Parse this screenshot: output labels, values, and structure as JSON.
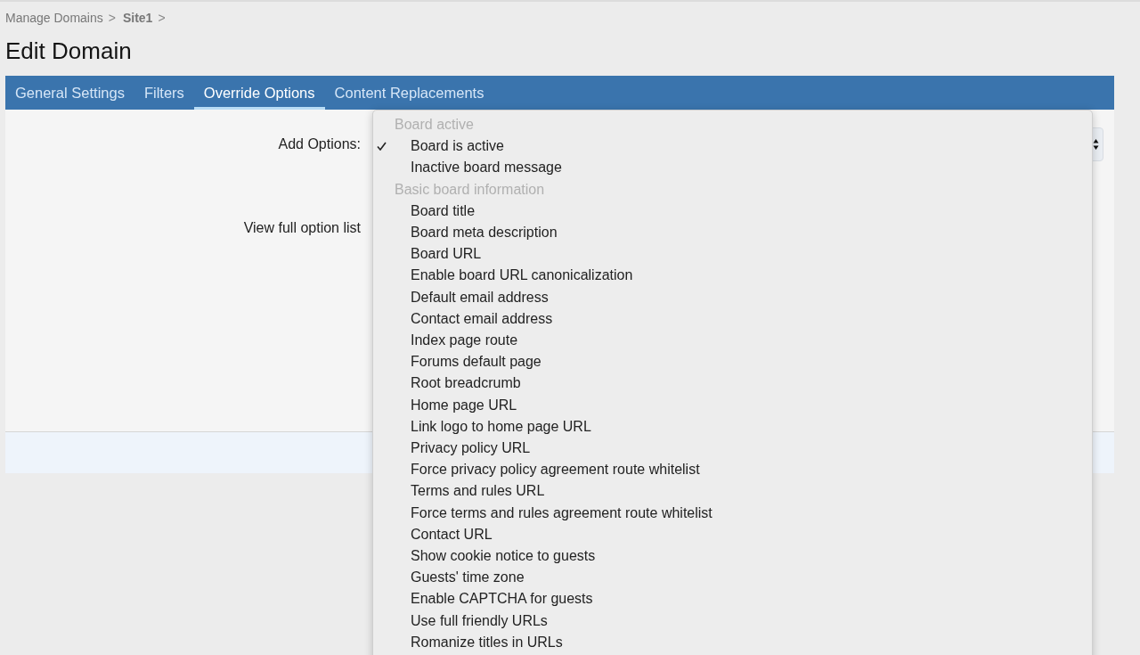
{
  "breadcrumb": [
    {
      "label": "Manage Domains",
      "bold": false
    },
    {
      "label": "Site1",
      "bold": true
    }
  ],
  "breadcrumb_separator": ">",
  "title": "Edit Domain",
  "tabs": [
    {
      "label": "General Settings",
      "selected": false
    },
    {
      "label": "Filters",
      "selected": false
    },
    {
      "label": "Override Options",
      "selected": true
    },
    {
      "label": "Content Replacements",
      "selected": false
    }
  ],
  "form": {
    "add_options_label": "Add Options:",
    "view_full_link": "View full option list"
  },
  "dropdown": [
    {
      "kind": "group",
      "label": "Board active"
    },
    {
      "kind": "option",
      "label": "Board is active",
      "checked": true
    },
    {
      "kind": "option",
      "label": "Inactive board message",
      "checked": false
    },
    {
      "kind": "group",
      "label": "Basic board information"
    },
    {
      "kind": "option",
      "label": "Board title",
      "checked": false
    },
    {
      "kind": "option",
      "label": "Board meta description",
      "checked": false
    },
    {
      "kind": "option",
      "label": "Board URL",
      "checked": false
    },
    {
      "kind": "option",
      "label": "Enable board URL canonicalization",
      "checked": false
    },
    {
      "kind": "option",
      "label": "Default email address",
      "checked": false
    },
    {
      "kind": "option",
      "label": "Contact email address",
      "checked": false
    },
    {
      "kind": "option",
      "label": "Index page route",
      "checked": false
    },
    {
      "kind": "option",
      "label": "Forums default page",
      "checked": false
    },
    {
      "kind": "option",
      "label": "Root breadcrumb",
      "checked": false
    },
    {
      "kind": "option",
      "label": "Home page URL",
      "checked": false
    },
    {
      "kind": "option",
      "label": "Link logo to home page URL",
      "checked": false
    },
    {
      "kind": "option",
      "label": "Privacy policy URL",
      "checked": false
    },
    {
      "kind": "option",
      "label": "Force privacy policy agreement route whitelist",
      "checked": false
    },
    {
      "kind": "option",
      "label": "Terms and rules URL",
      "checked": false
    },
    {
      "kind": "option",
      "label": "Force terms and rules agreement route whitelist",
      "checked": false
    },
    {
      "kind": "option",
      "label": "Contact URL",
      "checked": false
    },
    {
      "kind": "option",
      "label": "Show cookie notice to guests",
      "checked": false
    },
    {
      "kind": "option",
      "label": "Guests' time zone",
      "checked": false
    },
    {
      "kind": "option",
      "label": "Enable CAPTCHA for guests",
      "checked": false
    },
    {
      "kind": "option",
      "label": "Use full friendly URLs",
      "checked": false
    },
    {
      "kind": "option",
      "label": "Romanize titles in URLs",
      "checked": false
    }
  ]
}
